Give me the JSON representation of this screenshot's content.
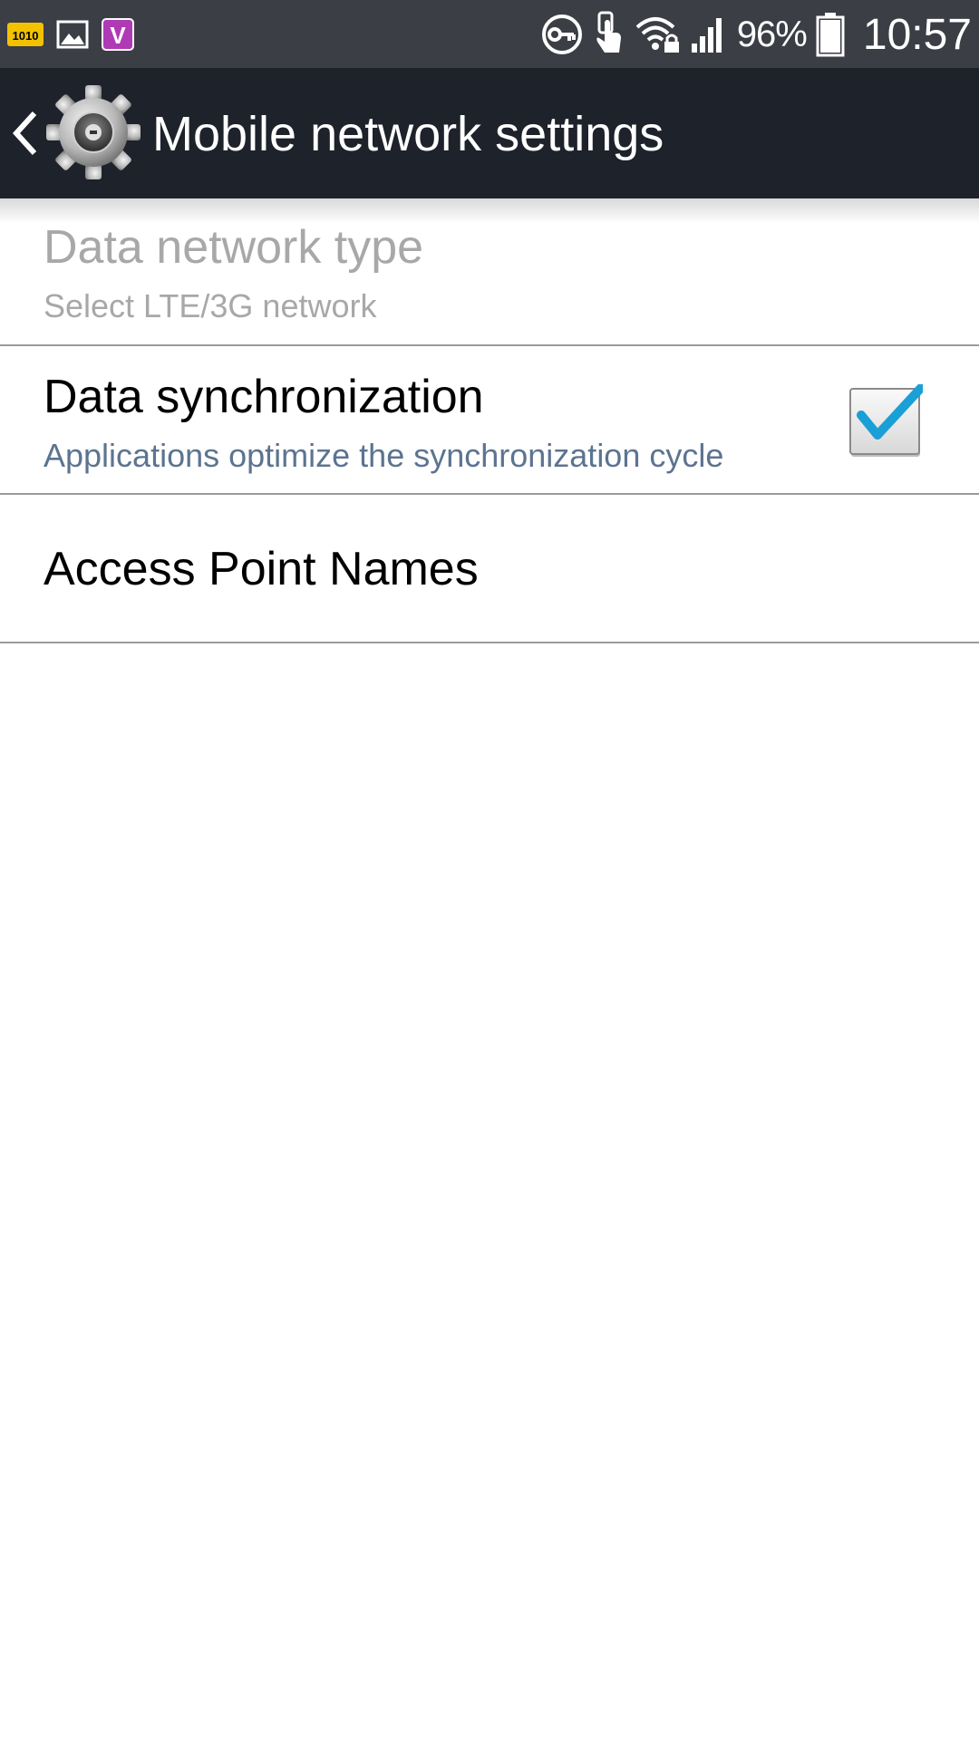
{
  "status_bar": {
    "left_icons": [
      {
        "icon": "1010-app-icon",
        "label": "1010",
        "color": "#f2c200"
      },
      {
        "icon": "picture-icon"
      },
      {
        "icon": "v-app-icon",
        "label": "V",
        "color": "#b03ab5"
      }
    ],
    "right_icons": [
      "vpn-key-icon",
      "touch-gesture-icon",
      "wifi-lock-icon",
      "signal-icon",
      "battery-icon"
    ],
    "battery_percent": "96%",
    "battery_level": 0.96,
    "time": "10:57"
  },
  "action_bar": {
    "back_icon": "chevron-left-icon",
    "app_icon": "gear-icon",
    "title": "Mobile network settings"
  },
  "settings": [
    {
      "title": "Data network type",
      "summary": "Select LTE/3G network",
      "enabled": false
    },
    {
      "title": "Data synchronization",
      "summary": "Applications optimize the synchronization cycle",
      "checked": true,
      "check_color": "#1a9fd6"
    },
    {
      "title": "Access Point Names"
    }
  ]
}
